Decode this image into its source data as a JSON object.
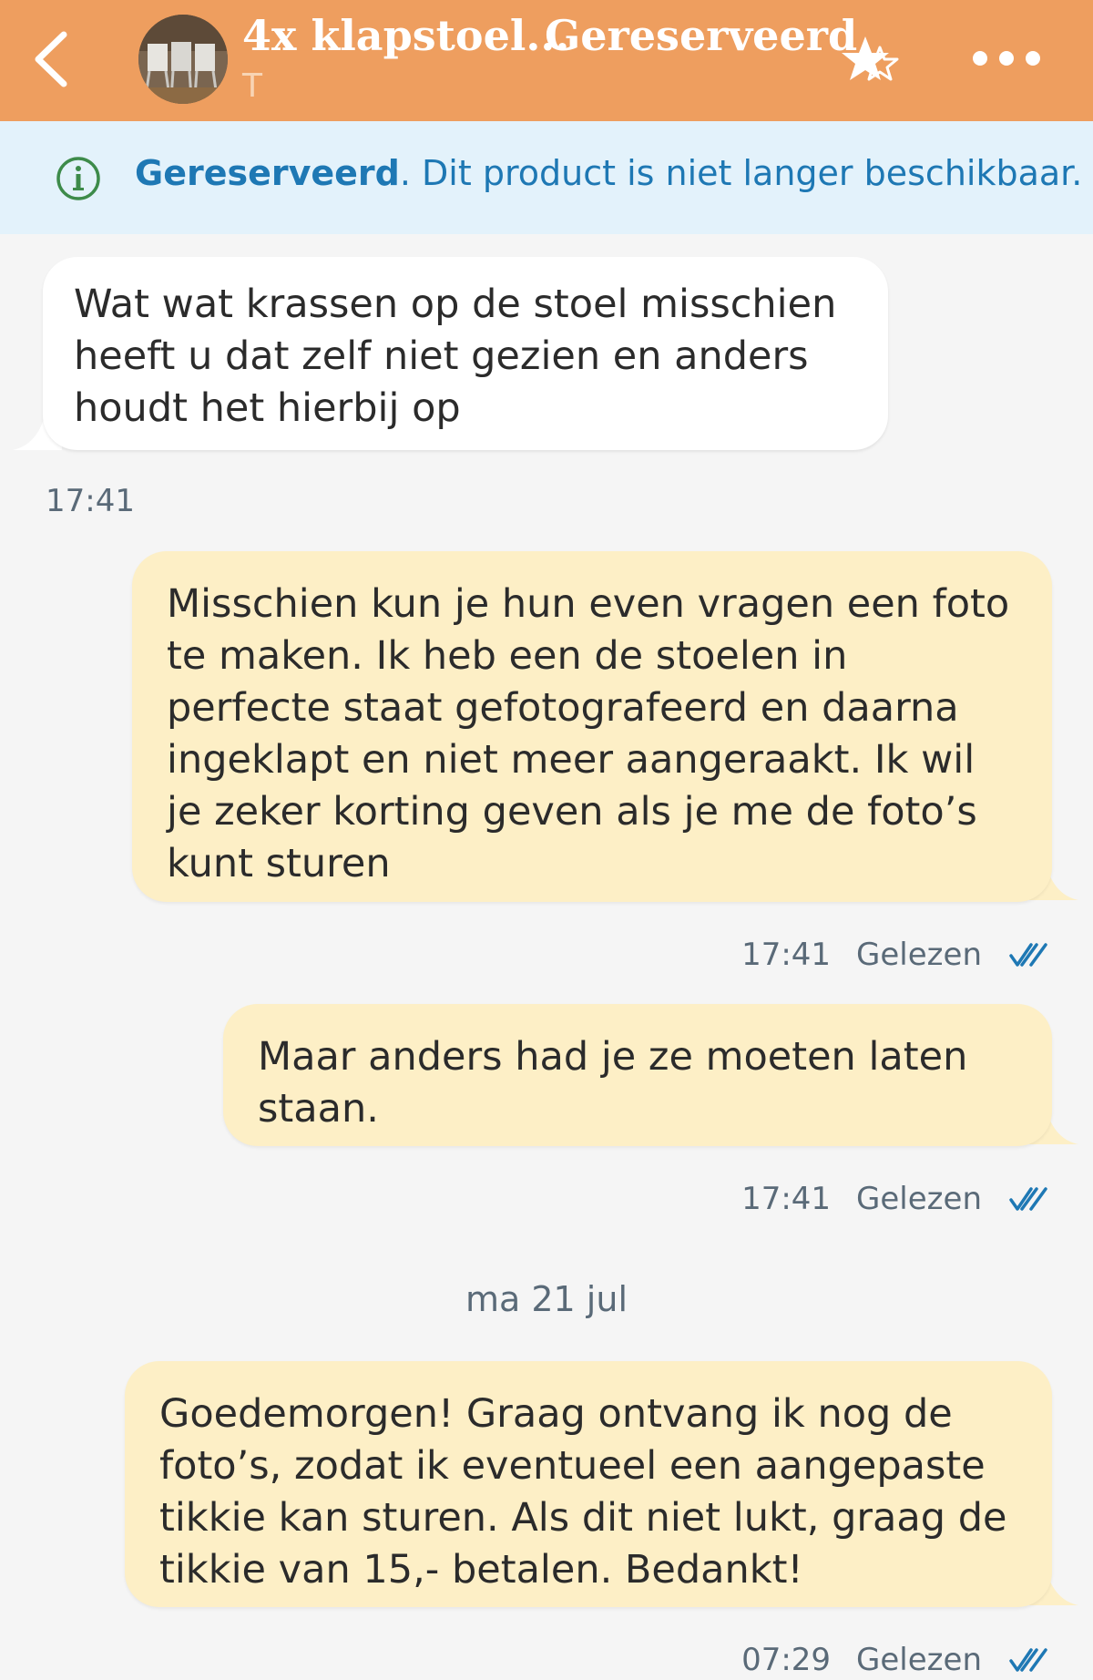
{
  "header": {
    "title": "4x klapstoel...",
    "status": "Gereserveerd",
    "seller": "T",
    "colors": {
      "bar": "#ee9e5f"
    },
    "icons": [
      "back-arrow-icon",
      "product-thumbnail",
      "favorite-star-icon",
      "more-options-icon"
    ]
  },
  "banner": {
    "bold": "Gereserveerd",
    "text": ". Dit product is niet langer beschikbaar.",
    "icon": "info-icon",
    "color": "#1e78b4"
  },
  "messages": [
    {
      "direction": "incoming",
      "text": "Wat wat krassen op de stoel misschien heeft u dat zelf niet gezien en anders houdt het hierbij op",
      "time": "17:41"
    },
    {
      "direction": "outgoing",
      "text": "Misschien kun je hun even vragen een foto te maken. Ik heb een de stoelen in perfecte staat gefotografeerd en daarna ingeklapt en niet meer aangeraakt. Ik wil je zeker korting geven als je me de foto’s kunt sturen",
      "time": "17:41",
      "receipt": "Gelezen"
    },
    {
      "direction": "outgoing",
      "text": "Maar anders had je ze moeten laten staan.",
      "time": "17:41",
      "receipt": "Gelezen"
    },
    {
      "direction": "outgoing",
      "text": "Goedemorgen! Graag ontvang ik nog de foto’s, zodat ik eventueel een aangepaste tikkie kan sturen. Als dit niet lukt, graag de tikkie van 15,- betalen. Bedankt!",
      "time": "07:29",
      "receipt": "Gelezen"
    }
  ],
  "date_separator": "ma 21 jul"
}
